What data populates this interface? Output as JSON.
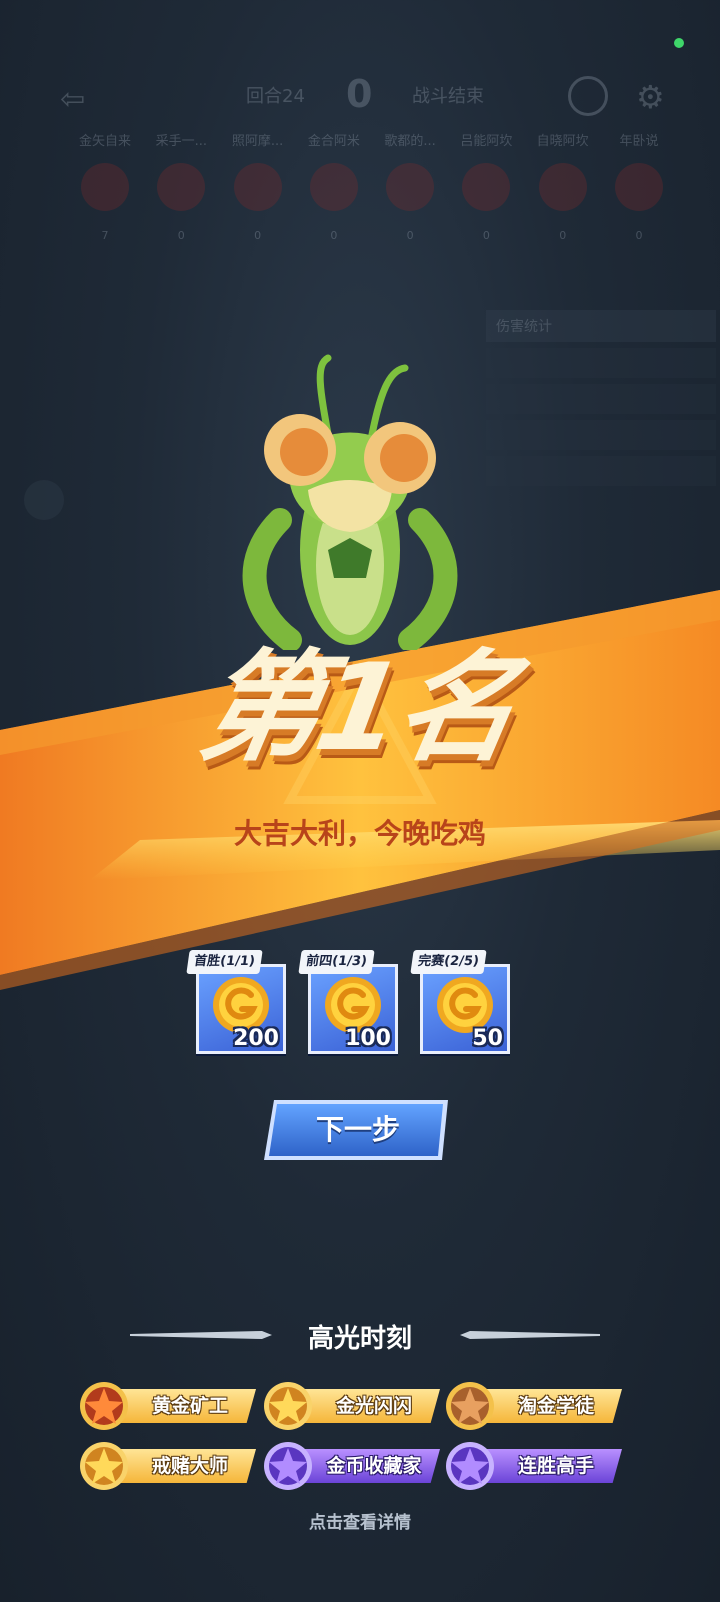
{
  "hud": {
    "round": "回合24",
    "score": "0",
    "state": "战斗结束",
    "players": [
      {
        "name": "金矢自来",
        "stat": "7"
      },
      {
        "name": "采手一...",
        "stat": "0"
      },
      {
        "name": "照阿摩...",
        "stat": "0"
      },
      {
        "name": "金合阿米",
        "stat": "0"
      },
      {
        "name": "歌都的...",
        "stat": "0"
      },
      {
        "name": "吕能阿坎",
        "stat": "0"
      },
      {
        "name": "自晓阿坎",
        "stat": "0"
      },
      {
        "name": "年卧说",
        "stat": "0"
      }
    ],
    "panel_title": "伤害统计"
  },
  "result": {
    "rank_title": "第1名",
    "slogan": "大吉大利，今晚吃鸡"
  },
  "rewards": [
    {
      "tag": "首胜(1/1)",
      "amount": "200",
      "icon": "gold-coin-icon"
    },
    {
      "tag": "前四(1/3)",
      "amount": "100",
      "icon": "gold-coin-icon"
    },
    {
      "tag": "完赛(2/5)",
      "amount": "50",
      "icon": "gold-coin-icon"
    }
  ],
  "next_button": {
    "label": "下一步"
  },
  "highlights": {
    "title": "高光时刻",
    "badges": [
      {
        "label": "黄金矿工",
        "color": "gold",
        "star": "red-star-icon"
      },
      {
        "label": "金光闪闪",
        "color": "gold",
        "star": "gold-star-icon"
      },
      {
        "label": "淘金学徒",
        "color": "gold",
        "star": "bronze-star-icon"
      },
      {
        "label": "戒赌大师",
        "color": "gold",
        "star": "gold-star-icon"
      },
      {
        "label": "金币收藏家",
        "color": "purple",
        "star": "purple-star-icon"
      },
      {
        "label": "连胜高手",
        "color": "purple",
        "star": "purple-star-icon"
      }
    ],
    "details_link": "点击查看详情"
  },
  "colors": {
    "banner_orange": "#f08a24",
    "banner_yellow": "#ffd04a",
    "reward_blue": "#4a7ae8",
    "button_blue": "#3f7fe0",
    "badge_gold": "#f5b63a",
    "badge_purple": "#7a52e0"
  }
}
